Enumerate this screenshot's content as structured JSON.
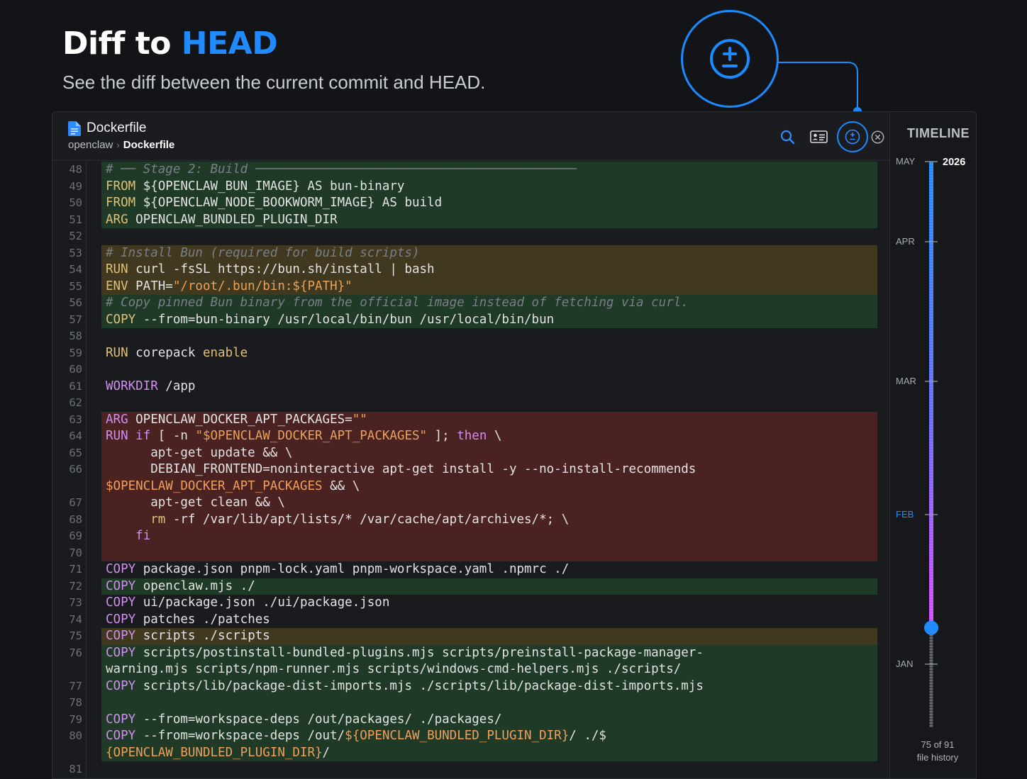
{
  "headline": {
    "prefix": "Diff to ",
    "accent": "HEAD"
  },
  "subtitle": "See the diff between the current commit and HEAD.",
  "editor": {
    "file_name": "Dockerfile",
    "breadcrumb": [
      "openclaw",
      "Dockerfile"
    ],
    "breadcrumb_separator": "›",
    "tools": [
      "search-icon",
      "contact-card-icon",
      "diff-to-head-icon",
      "close-icon"
    ]
  },
  "code_lines": [
    {
      "num": "48",
      "bg": "add",
      "parts": [
        [
          "cm",
          "# ── Stage 2: Build ───────────────────────────────────────────"
        ]
      ]
    },
    {
      "num": "49",
      "bg": "add",
      "parts": [
        [
          "kw",
          "FROM"
        ],
        [
          "",
          " ${OPENCLAW_BUN_IMAGE} AS bun-binary"
        ]
      ]
    },
    {
      "num": "50",
      "bg": "add",
      "parts": [
        [
          "kw",
          "FROM"
        ],
        [
          "",
          " ${OPENCLAW_NODE_BOOKWORM_IMAGE} AS build"
        ]
      ]
    },
    {
      "num": "51",
      "bg": "add",
      "parts": [
        [
          "kw",
          "ARG"
        ],
        [
          "",
          " OPENCLAW_BUNDLED_PLUGIN_DIR"
        ]
      ]
    },
    {
      "num": "52",
      "bg": "",
      "parts": [
        [
          "",
          ""
        ]
      ]
    },
    {
      "num": "53",
      "bg": "mod",
      "parts": [
        [
          "cm",
          "# Install Bun (required for build scripts)"
        ]
      ]
    },
    {
      "num": "54",
      "bg": "mod",
      "parts": [
        [
          "kw",
          "RUN"
        ],
        [
          "",
          " curl -fsSL https://bun.sh/install | bash"
        ]
      ]
    },
    {
      "num": "55",
      "bg": "mod",
      "parts": [
        [
          "kw",
          "ENV"
        ],
        [
          "",
          " PATH="
        ],
        [
          "str",
          "\"/root/.bun/bin:${PATH}\""
        ]
      ]
    },
    {
      "num": "56",
      "bg": "add",
      "parts": [
        [
          "cm",
          "# Copy pinned Bun binary from the official image instead of fetching via curl."
        ]
      ]
    },
    {
      "num": "57",
      "bg": "add",
      "parts": [
        [
          "kw",
          "COPY"
        ],
        [
          "",
          " --from=bun-binary /usr/local/bin/bun /usr/local/bin/bun"
        ]
      ]
    },
    {
      "num": "58",
      "bg": "",
      "parts": [
        [
          "",
          ""
        ]
      ]
    },
    {
      "num": "59",
      "bg": "",
      "parts": [
        [
          "kw",
          "RUN"
        ],
        [
          "",
          " corepack "
        ],
        [
          "kw",
          "enable"
        ]
      ]
    },
    {
      "num": "60",
      "bg": "",
      "parts": [
        [
          "",
          ""
        ]
      ]
    },
    {
      "num": "61",
      "bg": "",
      "parts": [
        [
          "kwp",
          "WORKDIR"
        ],
        [
          "",
          " /app"
        ]
      ]
    },
    {
      "num": "62",
      "bg": "",
      "parts": [
        [
          "",
          ""
        ]
      ]
    },
    {
      "num": "63",
      "bg": "del",
      "parts": [
        [
          "kwp",
          "ARG"
        ],
        [
          "",
          " OPENCLAW_DOCKER_APT_PACKAGES="
        ],
        [
          "str",
          "\"\""
        ]
      ]
    },
    {
      "num": "64",
      "bg": "del",
      "parts": [
        [
          "kwp",
          "RUN"
        ],
        [
          "",
          " "
        ],
        [
          "kwp",
          "if"
        ],
        [
          "",
          " [ -n "
        ],
        [
          "str",
          "\"$OPENCLAW_DOCKER_APT_PACKAGES\""
        ],
        [
          "",
          " ]; "
        ],
        [
          "kwp",
          "then"
        ],
        [
          "",
          " \\"
        ]
      ]
    },
    {
      "num": "65",
      "bg": "del",
      "parts": [
        [
          "",
          "      apt-get update && \\"
        ]
      ]
    },
    {
      "num": "66",
      "bg": "del",
      "parts": [
        [
          "",
          "      DEBIAN_FRONTEND=noninteractive apt-get install -y --no-install-recommends"
        ]
      ]
    },
    {
      "num": "",
      "bg": "del",
      "parts": [
        [
          "var",
          "$OPENCLAW_DOCKER_APT_PACKAGES"
        ],
        [
          "",
          " && \\"
        ]
      ]
    },
    {
      "num": "67",
      "bg": "del",
      "parts": [
        [
          "",
          "      apt-get clean && \\"
        ]
      ]
    },
    {
      "num": "68",
      "bg": "del",
      "parts": [
        [
          "",
          "      "
        ],
        [
          "kw",
          "rm"
        ],
        [
          "",
          " -rf /var/lib/apt/lists/* /var/cache/apt/archives/*; \\"
        ]
      ]
    },
    {
      "num": "69",
      "bg": "del",
      "parts": [
        [
          "",
          "    "
        ],
        [
          "kwp",
          "fi"
        ]
      ]
    },
    {
      "num": "70",
      "bg": "del",
      "parts": [
        [
          "",
          ""
        ]
      ]
    },
    {
      "num": "71",
      "bg": "",
      "parts": [
        [
          "kwp",
          "COPY"
        ],
        [
          "",
          " package.json pnpm-lock.yaml pnpm-workspace.yaml .npmrc ./"
        ]
      ]
    },
    {
      "num": "72",
      "bg": "add",
      "parts": [
        [
          "kwp",
          "COPY"
        ],
        [
          "",
          " openclaw.mjs ./"
        ]
      ]
    },
    {
      "num": "73",
      "bg": "",
      "parts": [
        [
          "kwp",
          "COPY"
        ],
        [
          "",
          " ui/package.json ./ui/package.json"
        ]
      ]
    },
    {
      "num": "74",
      "bg": "",
      "parts": [
        [
          "kwp",
          "COPY"
        ],
        [
          "",
          " patches ./patches"
        ]
      ]
    },
    {
      "num": "75",
      "bg": "mod",
      "parts": [
        [
          "kwp",
          "COPY"
        ],
        [
          "",
          " scripts ./scripts"
        ]
      ]
    },
    {
      "num": "76",
      "bg": "add",
      "parts": [
        [
          "kwp",
          "COPY"
        ],
        [
          "",
          " scripts/postinstall-bundled-plugins.mjs scripts/preinstall-package-manager-"
        ]
      ]
    },
    {
      "num": "",
      "bg": "add",
      "parts": [
        [
          "",
          "warning.mjs scripts/npm-runner.mjs scripts/windows-cmd-helpers.mjs ./scripts/"
        ]
      ]
    },
    {
      "num": "77",
      "bg": "add",
      "parts": [
        [
          "kwp",
          "COPY"
        ],
        [
          "",
          " scripts/lib/package-dist-imports.mjs ./scripts/lib/package-dist-imports.mjs"
        ]
      ]
    },
    {
      "num": "78",
      "bg": "add",
      "parts": [
        [
          "",
          ""
        ]
      ]
    },
    {
      "num": "79",
      "bg": "add",
      "parts": [
        [
          "kwp",
          "COPY"
        ],
        [
          "",
          " --from=workspace-deps /out/packages/ ./packages/"
        ]
      ]
    },
    {
      "num": "80",
      "bg": "add",
      "parts": [
        [
          "kwp",
          "COPY"
        ],
        [
          "",
          " --from=workspace-deps /out/"
        ],
        [
          "var",
          "${OPENCLAW_BUNDLED_PLUGIN_DIR}"
        ],
        [
          "",
          "/ ./$"
        ]
      ]
    },
    {
      "num": "",
      "bg": "add",
      "parts": [
        [
          "var",
          "{OPENCLAW_BUNDLED_PLUGIN_DIR}"
        ],
        [
          "",
          "/"
        ]
      ]
    },
    {
      "num": "81",
      "bg": "",
      "parts": [
        [
          "",
          ""
        ]
      ]
    }
  ],
  "timeline": {
    "title": "TIMELINE",
    "year": "2026",
    "months": [
      {
        "label": "MAY",
        "highlight": false
      },
      {
        "label": "APR",
        "highlight": false
      },
      {
        "label": "MAR",
        "highlight": false
      },
      {
        "label": "FEB",
        "highlight": true
      },
      {
        "label": "JAN",
        "highlight": false
      }
    ],
    "position_text": "75 of 91",
    "position_caption": "file history",
    "current": 75,
    "total": 91,
    "colors": {
      "blue": "#1f8bff",
      "magenta": "#d94bff",
      "highlight": "#1f8bff"
    }
  }
}
